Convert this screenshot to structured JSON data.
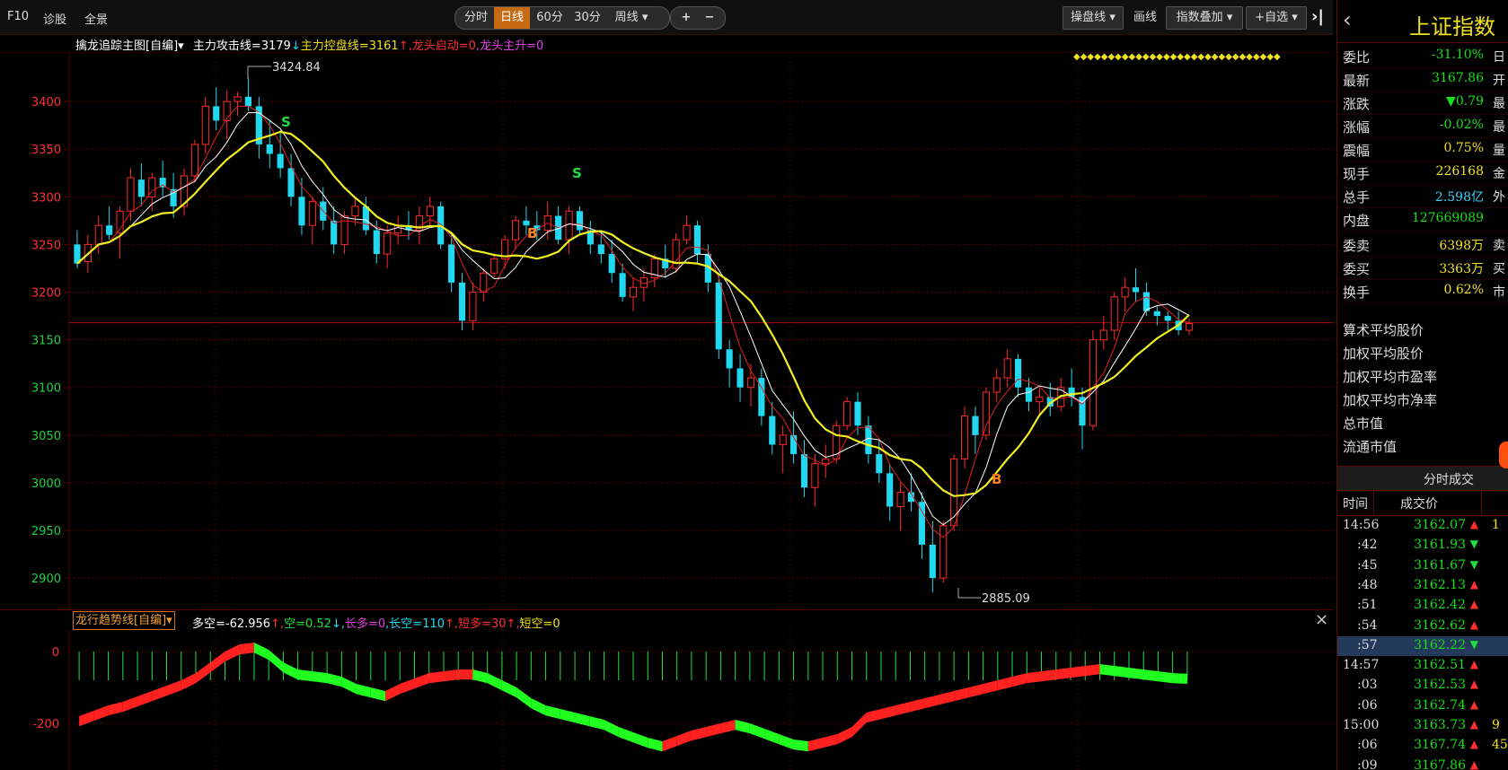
{
  "toolbar": {
    "left_links": [
      "F10",
      "诊股",
      "全景"
    ],
    "periods": [
      "分时",
      "日线",
      "60分",
      "30分",
      "周线"
    ],
    "zoom_in": "+",
    "zoom_out": "−",
    "right_buttons": [
      "操盘线",
      "画线",
      "指数叠加",
      "+自选"
    ],
    "collapse_icon": "chevron-bar-right-icon"
  },
  "main_indicator": {
    "name": "擒龙追踪主图[自编]",
    "attack_line": "主力攻击线=3179",
    "attack_arrow": "↓",
    "control_line": "主力控盘线=3161",
    "control_arrow": "↑",
    "dragon_start": "龙头启动=0",
    "dragon_rise": "龙头主升=0"
  },
  "price_axis": [
    "3400",
    "3350",
    "3300",
    "3250",
    "3200",
    "3150",
    "3100",
    "3050",
    "3000",
    "2950",
    "2900"
  ],
  "annotations": {
    "high": "3424.84",
    "low": "2885.09",
    "signals": [
      "S",
      "B",
      "S",
      "B"
    ]
  },
  "sub_indicator": {
    "name": "龙行趋势线[自编]",
    "duokong": "多空=-62.956",
    "kong": "空=0.52",
    "changduo": "长多=0",
    "changkong": "长空=110",
    "duanduo": "短多=30",
    "duankong": "短空=0",
    "axis": [
      "0",
      "-200"
    ],
    "close_icon": "×"
  },
  "quote_panel": {
    "title": "上证指数",
    "back_icon": "chevron-left-icon",
    "rows": [
      {
        "label": "委比",
        "value": "-31.10%",
        "color": "#18e018"
      },
      {
        "label": "最新",
        "value": "3167.86",
        "color": "#18e018"
      },
      {
        "label": "涨跌",
        "value": "▼0.79",
        "color": "#18e018"
      },
      {
        "label": "涨幅",
        "value": "-0.02%",
        "color": "#18e018"
      },
      {
        "label": "震幅",
        "value": "0.75%",
        "color": "#f0e020"
      },
      {
        "label": "现手",
        "value": "226168",
        "color": "#f0e020"
      },
      {
        "label": "总手",
        "value": "2.598亿",
        "color": "#3ad0ff"
      },
      {
        "label": "内盘",
        "value": "127669089",
        "color": "#18e018"
      },
      {
        "label": "委卖",
        "value": "6398万",
        "color": "#f0e020"
      },
      {
        "label": "委买",
        "value": "3363万",
        "color": "#f0e020"
      },
      {
        "label": "换手",
        "value": "0.62%",
        "color": "#f0e020"
      }
    ],
    "side_glyphs": [
      "日",
      "开",
      "最",
      "最",
      "量",
      "金",
      "外",
      "",
      "卖",
      "买",
      "市"
    ],
    "stats_labels": [
      "算术平均股价",
      "加权平均股价",
      "加权平均市盈率",
      "加权平均市净率",
      "总市值",
      "流通市值"
    ]
  },
  "ticks": {
    "title": "分时成交",
    "headers": [
      "时间",
      "成交价"
    ],
    "rows": [
      {
        "time": "14:56",
        "price": "3162.07",
        "dir": "▲",
        "extra": "1"
      },
      {
        "time": ":42",
        "price": "3161.93",
        "dir": "▼",
        "extra": ""
      },
      {
        "time": ":45",
        "price": "3161.67",
        "dir": "▼",
        "extra": ""
      },
      {
        "time": ":48",
        "price": "3162.13",
        "dir": "▲",
        "extra": ""
      },
      {
        "time": ":51",
        "price": "3162.42",
        "dir": "▲",
        "extra": ""
      },
      {
        "time": ":54",
        "price": "3162.62",
        "dir": "▲",
        "extra": ""
      },
      {
        "time": ":57",
        "price": "3162.22",
        "dir": "▼",
        "extra": ""
      },
      {
        "time": "14:57",
        "price": "3162.51",
        "dir": "▲",
        "extra": ""
      },
      {
        "time": ":03",
        "price": "3162.53",
        "dir": "▲",
        "extra": ""
      },
      {
        "time": ":06",
        "price": "3162.74",
        "dir": "▲",
        "extra": ""
      },
      {
        "time": "15:00",
        "price": "3163.73",
        "dir": "▲",
        "extra": "9"
      },
      {
        "time": ":06",
        "price": "3167.74",
        "dir": "▲",
        "extra": "45"
      },
      {
        "time": ":09",
        "price": "3167.86",
        "dir": "▲",
        "extra": ""
      }
    ]
  },
  "colors": {
    "up": "#ff2a2a",
    "down": "#21d8f0",
    "ma_yellow": "#f0f020",
    "ma_white": "#ffffff",
    "ma_red": "#e02020",
    "axis_red": "#ff3030",
    "axis_green": "#20d040",
    "grid": "#5a0000"
  },
  "chart_data": {
    "type": "candlestick",
    "ylim": [
      2870,
      3450
    ],
    "high_label": 3424.84,
    "low_label": 2885.09,
    "ohlc": [
      [
        3250,
        3265,
        3225,
        3230
      ],
      [
        3232,
        3260,
        3220,
        3250
      ],
      [
        3250,
        3280,
        3240,
        3270
      ],
      [
        3270,
        3290,
        3255,
        3260
      ],
      [
        3262,
        3290,
        3235,
        3285
      ],
      [
        3285,
        3330,
        3275,
        3320
      ],
      [
        3318,
        3335,
        3290,
        3300
      ],
      [
        3300,
        3325,
        3285,
        3320
      ],
      [
        3320,
        3338,
        3300,
        3310
      ],
      [
        3308,
        3325,
        3278,
        3290
      ],
      [
        3290,
        3330,
        3280,
        3322
      ],
      [
        3322,
        3360,
        3315,
        3355
      ],
      [
        3355,
        3405,
        3345,
        3395
      ],
      [
        3395,
        3415,
        3370,
        3380
      ],
      [
        3380,
        3412,
        3360,
        3400
      ],
      [
        3400,
        3410,
        3385,
        3405
      ],
      [
        3405,
        3425,
        3390,
        3395
      ],
      [
        3395,
        3405,
        3340,
        3355
      ],
      [
        3355,
        3380,
        3330,
        3345
      ],
      [
        3345,
        3370,
        3320,
        3330
      ],
      [
        3330,
        3345,
        3290,
        3300
      ],
      [
        3300,
        3320,
        3260,
        3270
      ],
      [
        3270,
        3300,
        3250,
        3295
      ],
      [
        3295,
        3310,
        3265,
        3275
      ],
      [
        3275,
        3290,
        3240,
        3250
      ],
      [
        3250,
        3285,
        3240,
        3280
      ],
      [
        3280,
        3300,
        3270,
        3290
      ],
      [
        3290,
        3300,
        3260,
        3265
      ],
      [
        3265,
        3275,
        3230,
        3240
      ],
      [
        3240,
        3270,
        3225,
        3262
      ],
      [
        3262,
        3280,
        3250,
        3270
      ],
      [
        3270,
        3285,
        3255,
        3265
      ],
      [
        3265,
        3290,
        3250,
        3280
      ],
      [
        3280,
        3300,
        3270,
        3290
      ],
      [
        3290,
        3295,
        3245,
        3250
      ],
      [
        3250,
        3260,
        3200,
        3210
      ],
      [
        3210,
        3220,
        3160,
        3170
      ],
      [
        3170,
        3210,
        3160,
        3200
      ],
      [
        3200,
        3225,
        3190,
        3220
      ],
      [
        3220,
        3240,
        3215,
        3235
      ],
      [
        3235,
        3260,
        3225,
        3255
      ],
      [
        3255,
        3280,
        3245,
        3275
      ],
      [
        3275,
        3290,
        3260,
        3270
      ],
      [
        3270,
        3285,
        3255,
        3265
      ],
      [
        3265,
        3295,
        3255,
        3280
      ],
      [
        3280,
        3290,
        3250,
        3255
      ],
      [
        3255,
        3290,
        3240,
        3285
      ],
      [
        3285,
        3290,
        3260,
        3265
      ],
      [
        3265,
        3275,
        3240,
        3250
      ],
      [
        3250,
        3262,
        3230,
        3240
      ],
      [
        3240,
        3255,
        3210,
        3220
      ],
      [
        3220,
        3230,
        3190,
        3195
      ],
      [
        3195,
        3215,
        3180,
        3205
      ],
      [
        3205,
        3225,
        3190,
        3215
      ],
      [
        3215,
        3240,
        3205,
        3235
      ],
      [
        3235,
        3250,
        3215,
        3225
      ],
      [
        3225,
        3262,
        3220,
        3255
      ],
      [
        3255,
        3280,
        3250,
        3270
      ],
      [
        3270,
        3275,
        3230,
        3240
      ],
      [
        3240,
        3250,
        3200,
        3210
      ],
      [
        3210,
        3220,
        3130,
        3140
      ],
      [
        3140,
        3150,
        3100,
        3120
      ],
      [
        3120,
        3135,
        3085,
        3100
      ],
      [
        3100,
        3125,
        3080,
        3110
      ],
      [
        3110,
        3120,
        3060,
        3070
      ],
      [
        3070,
        3085,
        3030,
        3040
      ],
      [
        3040,
        3060,
        3010,
        3050
      ],
      [
        3050,
        3075,
        3020,
        3030
      ],
      [
        3030,
        3045,
        2985,
        2995
      ],
      [
        2995,
        3030,
        2975,
        3020
      ],
      [
        3020,
        3040,
        3005,
        3025
      ],
      [
        3025,
        3065,
        3020,
        3060
      ],
      [
        3060,
        3090,
        3055,
        3085
      ],
      [
        3085,
        3095,
        3050,
        3060
      ],
      [
        3060,
        3070,
        3020,
        3030
      ],
      [
        3030,
        3045,
        3000,
        3010
      ],
      [
        3010,
        3020,
        2960,
        2975
      ],
      [
        2975,
        3000,
        2950,
        2990
      ],
      [
        2990,
        3010,
        2970,
        2980
      ],
      [
        2980,
        2990,
        2920,
        2935
      ],
      [
        2935,
        2960,
        2885,
        2900
      ],
      [
        2900,
        2960,
        2895,
        2955
      ],
      [
        2955,
        3030,
        2950,
        3025
      ],
      [
        3025,
        3080,
        3015,
        3070
      ],
      [
        3070,
        3080,
        3030,
        3050
      ],
      [
        3050,
        3100,
        3045,
        3095
      ],
      [
        3095,
        3120,
        3085,
        3110
      ],
      [
        3110,
        3140,
        3100,
        3130
      ],
      [
        3130,
        3135,
        3090,
        3100
      ],
      [
        3100,
        3110,
        3075,
        3085
      ],
      [
        3085,
        3100,
        3070,
        3090
      ],
      [
        3090,
        3105,
        3070,
        3080
      ],
      [
        3080,
        3110,
        3075,
        3100
      ],
      [
        3100,
        3120,
        3080,
        3090
      ],
      [
        3090,
        3100,
        3035,
        3060
      ],
      [
        3060,
        3160,
        3055,
        3150
      ],
      [
        3150,
        3175,
        3140,
        3160
      ],
      [
        3160,
        3200,
        3150,
        3195
      ],
      [
        3195,
        3215,
        3180,
        3205
      ],
      [
        3205,
        3225,
        3190,
        3200
      ],
      [
        3200,
        3210,
        3175,
        3180
      ],
      [
        3180,
        3185,
        3165,
        3175
      ],
      [
        3175,
        3180,
        3160,
        3170
      ],
      [
        3170,
        3180,
        3155,
        3160
      ],
      [
        3160,
        3172,
        3155,
        3167
      ]
    ],
    "sub_series": {
      "name": "多空",
      "ylim": [
        -330,
        60
      ],
      "values": [
        -180,
        -165,
        -150,
        -140,
        -125,
        -110,
        -95,
        -80,
        -60,
        -30,
        0,
        20,
        25,
        5,
        -30,
        -50,
        -55,
        -60,
        -70,
        -90,
        -100,
        -110,
        -90,
        -75,
        -60,
        -55,
        -50,
        -50,
        -60,
        -80,
        -100,
        -130,
        -150,
        -160,
        -170,
        -180,
        -190,
        -210,
        -225,
        -240,
        -250,
        -235,
        -220,
        -210,
        -200,
        -190,
        -200,
        -215,
        -230,
        -245,
        -250,
        -240,
        -230,
        -210,
        -170,
        -160,
        -150,
        -140,
        -130,
        -120,
        -110,
        -100,
        -90,
        -80,
        -70,
        -60,
        -55,
        -50,
        -45,
        -40,
        -35,
        -40,
        -45,
        -50,
        -55,
        -60,
        -62
      ]
    }
  }
}
